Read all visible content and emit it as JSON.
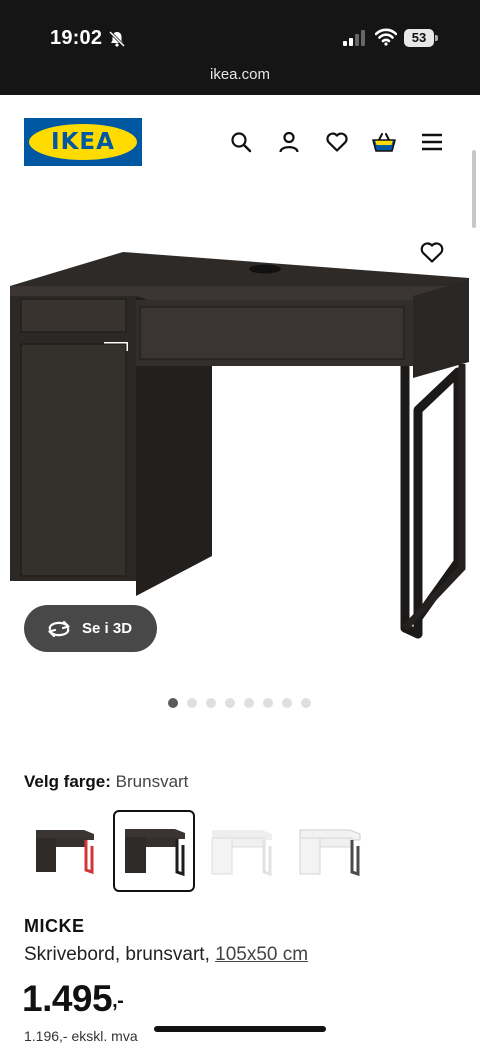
{
  "status_bar": {
    "time": "19:02",
    "battery": "53"
  },
  "browser": {
    "url": "ikea.com"
  },
  "header": {
    "logo_text": "IKEA",
    "icons": [
      "search-icon",
      "user-icon",
      "heart-icon",
      "basket-icon",
      "menu-icon"
    ]
  },
  "gallery": {
    "view_3d_label": "Se i 3D",
    "dot_count": 8,
    "active_dot": 0
  },
  "color_select": {
    "label": "Velg farge:",
    "value": "Brunsvart",
    "options": [
      "brunsvart-rød",
      "brunsvart",
      "hvit",
      "hvit-antrasitt"
    ],
    "selected_index": 1
  },
  "product": {
    "name": "MICKE",
    "description_prefix": "Skrivebord, brunsvart, ",
    "dimensions": "105x50 cm",
    "price": "1.495",
    "price_suffix": ",-",
    "price_ex_vat": "1.196,- ekskl. mva"
  },
  "colors": {
    "ikea_blue": "#0058a3",
    "ikea_yellow": "#ffdb00",
    "desk_brown_black": "#3a3532",
    "pill_bg": "#484848"
  }
}
